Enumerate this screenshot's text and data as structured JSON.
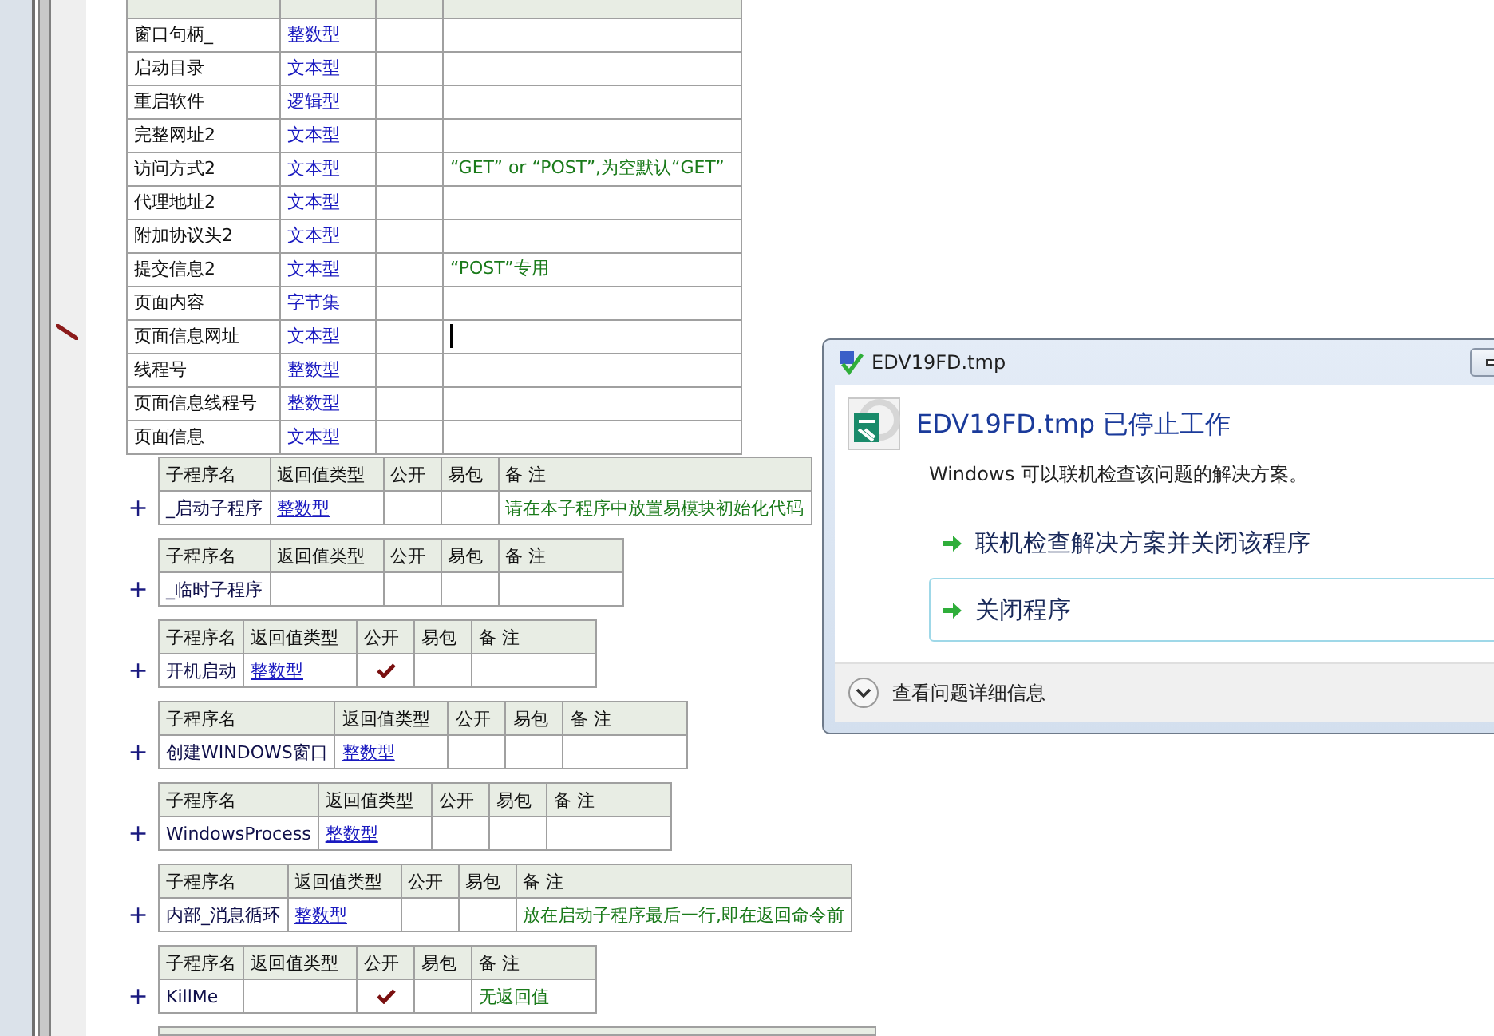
{
  "variables": {
    "rows": [
      {
        "name": "窗口句柄_",
        "type": "整数型",
        "current": false
      },
      {
        "name": "启动目录",
        "type": "文本型",
        "current": false
      },
      {
        "name": "重启软件",
        "type": "逻辑型",
        "current": false
      },
      {
        "name": "完整网址2",
        "type": "文本型",
        "current": false
      },
      {
        "name": "访问方式2",
        "type": "文本型",
        "note": "“GET” or “POST”,为空默认“GET”",
        "current": false
      },
      {
        "name": "代理地址2",
        "type": "文本型",
        "current": false
      },
      {
        "name": "附加协议头2",
        "type": "文本型",
        "current": false
      },
      {
        "name": "提交信息2",
        "type": "文本型",
        "note": "“POST”专用",
        "current": false
      },
      {
        "name": "页面内容",
        "type": "字节集",
        "current": false
      },
      {
        "name": "页面信息网址",
        "type": "文本型",
        "current": true
      },
      {
        "name": "线程号",
        "type": "整数型",
        "current": false
      },
      {
        "name": "页面信息线程号",
        "type": "整数型",
        "current": false
      },
      {
        "name": "页面信息",
        "type": "文本型",
        "current": false
      }
    ]
  },
  "subroutines": [
    {
      "sign": "+",
      "columns": [
        "子程序名",
        "返回值类型",
        "公开",
        "易包",
        "备 注"
      ],
      "name": "_启动子程序",
      "return_type": "整数型",
      "public": false,
      "note": "请在本子程序中放置易模块初始化代码"
    },
    {
      "sign": "+",
      "columns": [
        "子程序名",
        "返回值类型",
        "公开",
        "易包",
        "备 注"
      ],
      "name": "_临时子程序",
      "public": false
    },
    {
      "sign": "+",
      "columns": [
        "子程序名",
        "返回值类型",
        "公开",
        "易包",
        "备 注"
      ],
      "name": "开机启动",
      "return_type": "整数型",
      "public": true
    },
    {
      "sign": "+",
      "columns": [
        "子程序名",
        "返回值类型",
        "公开",
        "易包",
        "备 注"
      ],
      "name": "创建WINDOWS窗口",
      "return_type": "整数型",
      "public": false
    },
    {
      "sign": "+",
      "columns": [
        "子程序名",
        "返回值类型",
        "公开",
        "易包",
        "备 注"
      ],
      "name": "WindowsProcess",
      "return_type": "整数型",
      "public": false
    },
    {
      "sign": "+",
      "columns": [
        "子程序名",
        "返回值类型",
        "公开",
        "易包",
        "备 注"
      ],
      "name": "内部_消息循环",
      "return_type": "整数型",
      "public": false,
      "note": "放在启动子程序最后一行,即在返回命令前"
    },
    {
      "sign": "+",
      "columns": [
        "子程序名",
        "返回值类型",
        "公开",
        "易包",
        "备 注"
      ],
      "name": "KillMe",
      "public": true,
      "note": "无返回值"
    }
  ],
  "more_below": true,
  "dialog": {
    "title": "EDV19FD.tmp",
    "heading": "EDV19FD.tmp 已停止工作",
    "message": "Windows 可以联机检查该问题的解决方案。",
    "options": [
      {
        "label": "联机检查解决方案并关闭该程序",
        "highlighted": false
      },
      {
        "label": "关闭程序",
        "highlighted": true
      }
    ],
    "details": "查看问题详细信息"
  }
}
